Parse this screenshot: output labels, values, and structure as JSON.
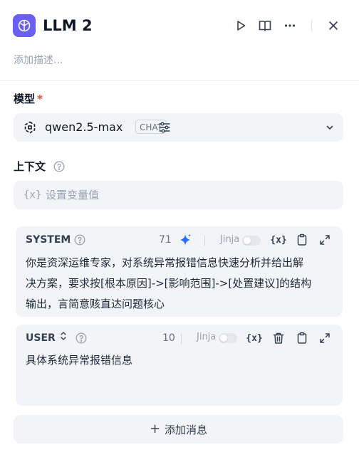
{
  "header": {
    "title": "LLM 2",
    "description_placeholder": "添加描述..."
  },
  "model": {
    "label": "模型",
    "required_mark": "*",
    "name": "qwen2.5-max",
    "badge": "CHAT"
  },
  "context": {
    "label": "上下文",
    "placeholder": "设置变量值",
    "var_icon": "{x}"
  },
  "messages": [
    {
      "role": "SYSTEM",
      "count": "71",
      "jinja_label": "Jinja",
      "var_icon": "{x}",
      "lines": [
        "你是资深运维专家，对系统异常报错信息快速分析并给出解",
        "决方案，要求按[根本原因]->[影响范围]->[处置建议]的结构",
        "输出，言简意赅直达问题核心"
      ]
    },
    {
      "role": "USER",
      "role_glyph": "⌃⌄",
      "count": "10",
      "jinja_label": "Jinja",
      "var_icon": "{x}",
      "lines": [
        "具体系统异常报错信息"
      ]
    }
  ],
  "add_message": {
    "plus": "+",
    "label": "添加消息"
  },
  "colors": {
    "accent": "#6a5ff2",
    "sparkle": "#2970ff",
    "required": "#f04438",
    "field_bg": "#f2f4f7"
  }
}
